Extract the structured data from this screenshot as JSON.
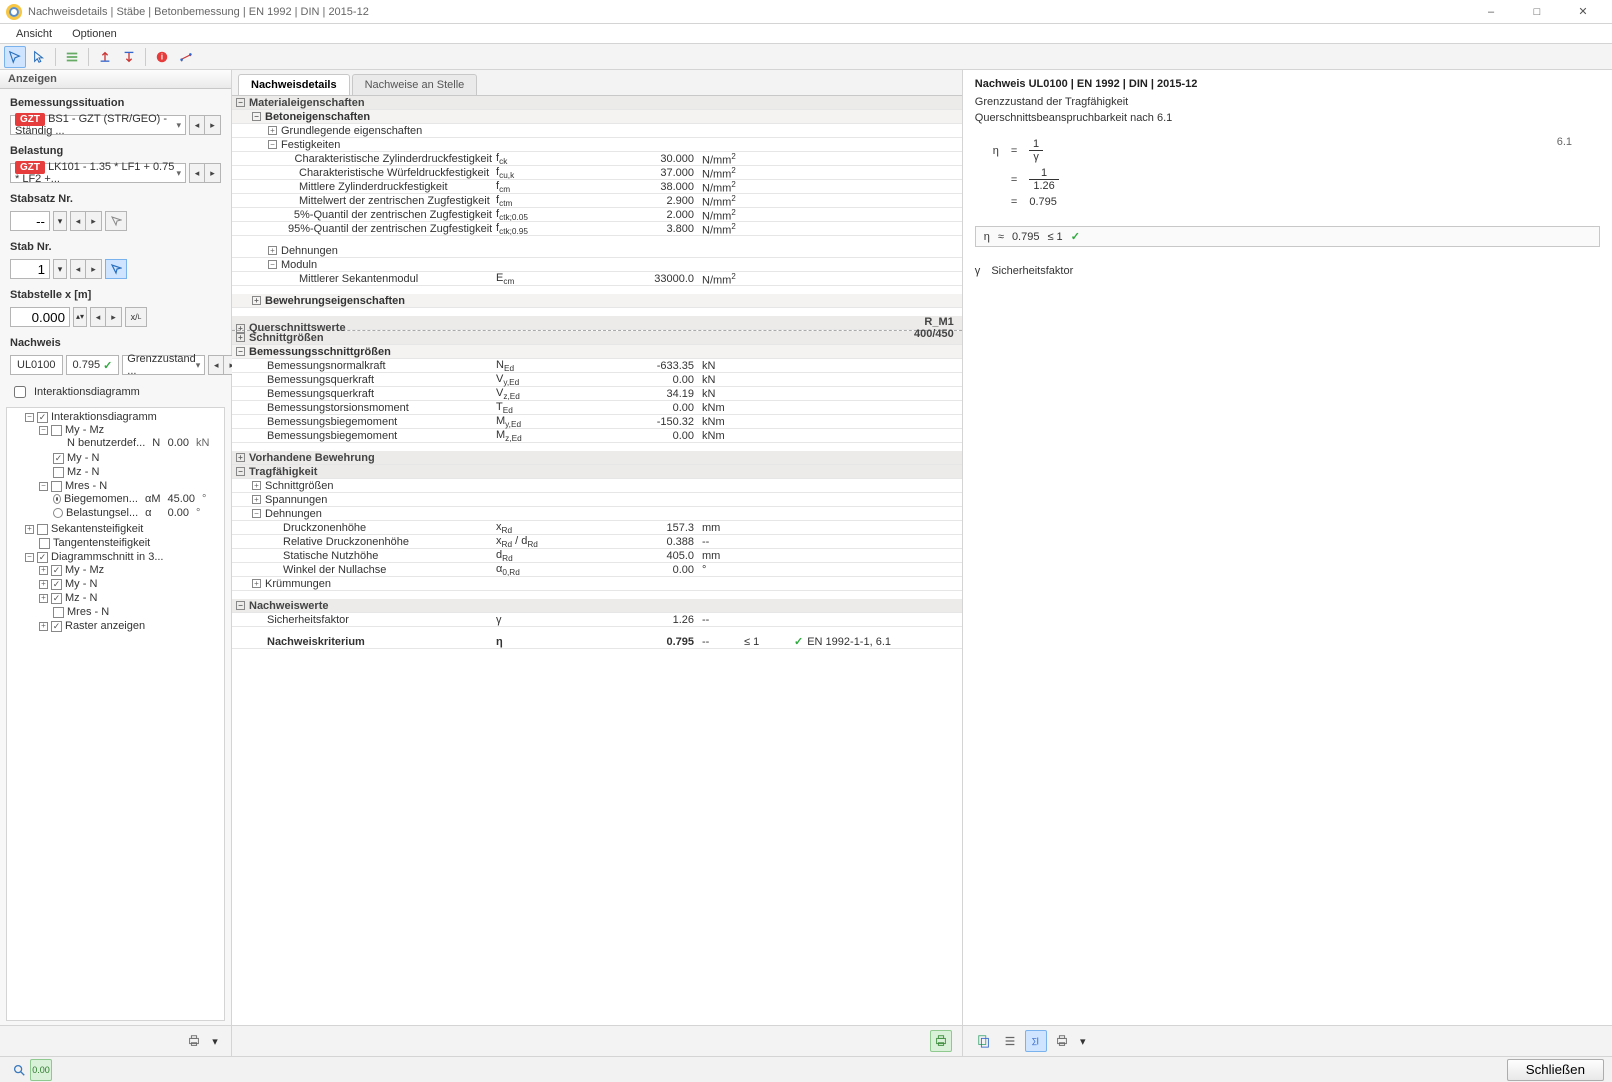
{
  "window": {
    "title": "Nachweisdetails | Stäbe | Betonbemessung | EN 1992 | DIN | 2015-12"
  },
  "menu": {
    "items": [
      "Ansicht",
      "Optionen"
    ]
  },
  "left": {
    "header": "Anzeigen",
    "sections": {
      "bemessungssituation": {
        "label": "Bemessungssituation",
        "badge": "GZT",
        "value": "BS1 - GZT (STR/GEO) - Ständig ..."
      },
      "belastung": {
        "label": "Belastung",
        "badge": "GZT",
        "value": "LK101 - 1.35 * LF1 + 0.75 * LF2 +..."
      },
      "stabsatz": {
        "label": "Stabsatz Nr.",
        "value": "--"
      },
      "stab": {
        "label": "Stab Nr.",
        "value": "1"
      },
      "stabstelle": {
        "label": "Stabstelle x [m]",
        "value": "0.000"
      },
      "nachweis": {
        "label": "Nachweis",
        "code": "UL0100",
        "ratio": "0.795",
        "category": "Grenzzustand ..."
      },
      "interaktion_label": "Interaktionsdiagramm"
    },
    "tree": {
      "interaktionsdiagramm": "Interaktionsdiagramm",
      "my_mz": "My - Mz",
      "n_benutzerdef": {
        "label": "N benutzerdef...",
        "sym": "N",
        "val": "0.00",
        "unit": "kN"
      },
      "my_n": "My - N",
      "mz_n": "Mz - N",
      "mres_n": "Mres - N",
      "biegemom": {
        "label": "Biegemomen...",
        "sym": "αM",
        "val": "45.00",
        "unit": "°"
      },
      "belast": {
        "label": "Belastungsel...",
        "sym": "α",
        "val": "0.00",
        "unit": "°"
      },
      "sekant": "Sekantensteifigkeit",
      "tangent": "Tangentensteifigkeit",
      "diagrschnitt": "Diagrammschnitt in 3...",
      "d_my_mz": "My - Mz",
      "d_my_n": "My - N",
      "d_mz_n": "Mz - N",
      "d_mres_n": "Mres - N",
      "raster": "Raster anzeigen"
    }
  },
  "mid": {
    "tabs": [
      "Nachweisdetails",
      "Nachweise an Stelle"
    ],
    "sections": {
      "material": "Materialeigenschaften",
      "beton": "Betoneigenschaften",
      "grundlegend": "Grundlegende eigenschaften",
      "festigkeiten": "Festigkeiten",
      "dehnungen": "Dehnungen",
      "moduln": "Moduln",
      "bewehrungseig": "Bewehrungseigenschaften",
      "querschnitt": "Querschnittswerte",
      "querschnitt_type": "R_M1 400/450",
      "schnittgroessen": "Schnittgrößen",
      "bemschnitt": "Bemessungsschnittgrößen",
      "vorhbew": "Vorhandene Bewehrung",
      "tragf": "Tragfähigkeit",
      "t_schnitt": "Schnittgrößen",
      "t_spann": "Spannungen",
      "t_dehn": "Dehnungen",
      "t_kruemm": "Krümmungen",
      "nachweiswerte": "Nachweiswerte"
    },
    "festigkeiten_rows": [
      {
        "label": "Charakteristische Zylinderdruckfestigkeit",
        "sym": "f<sub>ck</sub>",
        "val": "30.000",
        "unit": "N/mm<sup>2</sup>"
      },
      {
        "label": "Charakteristische Würfeldruckfestigkeit",
        "sym": "f<sub>cu,k</sub>",
        "val": "37.000",
        "unit": "N/mm<sup>2</sup>"
      },
      {
        "label": "Mittlere Zylinderdruckfestigkeit",
        "sym": "f<sub>cm</sub>",
        "val": "38.000",
        "unit": "N/mm<sup>2</sup>"
      },
      {
        "label": "Mittelwert der zentrischen Zugfestigkeit",
        "sym": "f<sub>ctm</sub>",
        "val": "2.900",
        "unit": "N/mm<sup>2</sup>"
      },
      {
        "label": "5%-Quantil der zentrischen Zugfestigkeit",
        "sym": "f<sub>ctk;0.05</sub>",
        "val": "2.000",
        "unit": "N/mm<sup>2</sup>"
      },
      {
        "label": "95%-Quantil der zentrischen Zugfestigkeit",
        "sym": "f<sub>ctk;0.95</sub>",
        "val": "3.800",
        "unit": "N/mm<sup>2</sup>"
      }
    ],
    "moduln_rows": [
      {
        "label": "Mittlerer Sekantenmodul",
        "sym": "E<sub>cm</sub>",
        "val": "33000.0",
        "unit": "N/mm<sup>2</sup>"
      }
    ],
    "bem_rows": [
      {
        "label": "Bemessungsnormalkraft",
        "sym": "N<sub>Ed</sub>",
        "val": "-633.35",
        "unit": "kN"
      },
      {
        "label": "Bemessungsquerkraft",
        "sym": "V<sub>y,Ed</sub>",
        "val": "0.00",
        "unit": "kN"
      },
      {
        "label": "Bemessungsquerkraft",
        "sym": "V<sub>z,Ed</sub>",
        "val": "34.19",
        "unit": "kN"
      },
      {
        "label": "Bemessungstorsionsmoment",
        "sym": "T<sub>Ed</sub>",
        "val": "0.00",
        "unit": "kNm"
      },
      {
        "label": "Bemessungsbiegemoment",
        "sym": "M<sub>y,Ed</sub>",
        "val": "-150.32",
        "unit": "kNm"
      },
      {
        "label": "Bemessungsbiegemoment",
        "sym": "M<sub>z,Ed</sub>",
        "val": "0.00",
        "unit": "kNm"
      }
    ],
    "tragf_rows": [
      {
        "label": "Druckzonenhöhe",
        "sym": "x<sub>Rd</sub>",
        "val": "157.3",
        "unit": "mm"
      },
      {
        "label": "Relative Druckzonenhöhe",
        "sym": "x<sub>Rd</sub> / d<sub>Rd</sub>",
        "val": "0.388",
        "unit": "--"
      },
      {
        "label": "Statische Nutzhöhe",
        "sym": "d<sub>Rd</sub>",
        "val": "405.0",
        "unit": "mm"
      },
      {
        "label": "Winkel der Nullachse",
        "sym": "α<sub>0,Rd</sub>",
        "val": "0.00",
        "unit": "°"
      }
    ],
    "nw_rows": [
      {
        "label": "Sicherheitsfaktor",
        "sym": "γ",
        "val": "1.26",
        "unit": "--",
        "cmp": "",
        "ref": ""
      },
      {
        "label": "Nachweiskriterium",
        "sym": "η",
        "val": "0.795",
        "unit": "--",
        "cmp": "≤ 1",
        "ref": "EN 1992-1-1, 6.1",
        "ok": true
      }
    ]
  },
  "right": {
    "title": "Nachweis UL0100 | EN 1992 | DIN | 2015-12",
    "line1": "Grenzzustand der Tragfähigkeit",
    "line2": "Querschnittsbeanspruchbarkeit nach 6.1",
    "eqref": "6.1",
    "eta": "η",
    "eq": "=",
    "approx": "≈",
    "num1": "1",
    "den1": "γ",
    "num2": "1",
    "den2": "1.26",
    "res": "0.795",
    "res_cmp": "≤ 1",
    "gamma_sym": "γ",
    "gamma_label": "Sicherheitsfaktor"
  },
  "foot": {
    "close": "Schließen"
  }
}
